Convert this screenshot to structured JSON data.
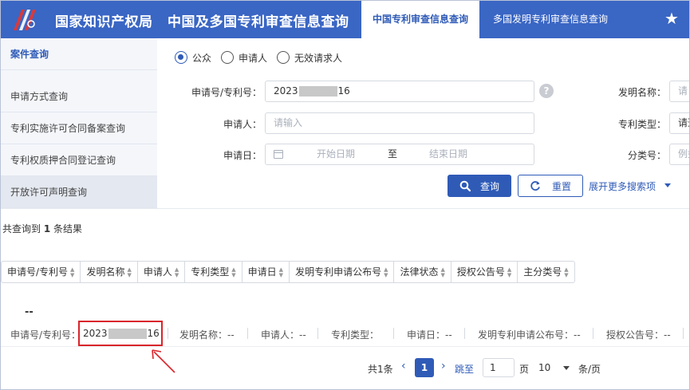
{
  "header": {
    "brand": "国家知识产权局",
    "system_title": "中国及多国专利审查信息查询",
    "tabs": [
      {
        "label": "中国专利审查信息查询",
        "active": true
      },
      {
        "label": "多国发明专利审查信息查询",
        "active": false
      }
    ],
    "star_icon": "star-icon",
    "accent": "#3a66c4"
  },
  "sidebar": {
    "items": [
      {
        "label": "案件查询"
      },
      {
        "label": "申请方式查询"
      },
      {
        "label": "专利实施许可合同备案查询"
      },
      {
        "label": "专利权质押合同登记查询"
      },
      {
        "label": "开放许可声明查询"
      }
    ]
  },
  "form": {
    "roles": [
      "公众",
      "申请人",
      "无效请求人"
    ],
    "selected_role": "公众",
    "app_no_label": "申请号/专利号：",
    "app_no_prefix": "2023",
    "app_no_suffix": "16",
    "applicant_label": "申请人：",
    "applicant_placeholder": "请输入",
    "date_label": "申请日：",
    "start_placeholder": "开始日期",
    "date_sep": "至",
    "end_placeholder": "结束日期",
    "invention_label": "发明名称：",
    "invention_placeholder": "请",
    "type_label": "专利类型：",
    "type_placeholder": "请选",
    "class_label": "分类号：",
    "class_placeholder": "例如",
    "query_button": "查询",
    "reset_button": "重置",
    "more_link": "展开更多搜索项"
  },
  "results": {
    "summary_prefix": "共查询到",
    "count": "1",
    "summary_suffix": "条结果",
    "sort_columns": [
      "申请号/专利号",
      "发明名称",
      "申请人",
      "专利类型",
      "申请日",
      "发明专利申请公布号",
      "法律状态",
      "授权公告号",
      "主分类号"
    ],
    "row": {
      "title": "--",
      "app_no_label": "申请号/专利号：",
      "app_no_prefix": "2023",
      "app_no_suffix": "16",
      "invention": "发明名称：--",
      "applicant": "申请人：--",
      "type": "专利类型：",
      "date": "申请日：--",
      "pub_no": "发明专利申请公布号：--",
      "grant_no": "授权公告号：--"
    }
  },
  "pagination": {
    "total": "共1条",
    "current": "1",
    "jump_label": "跳至",
    "jump_value": "1",
    "page_label": "页",
    "page_size": "10",
    "unit": "条/页"
  }
}
